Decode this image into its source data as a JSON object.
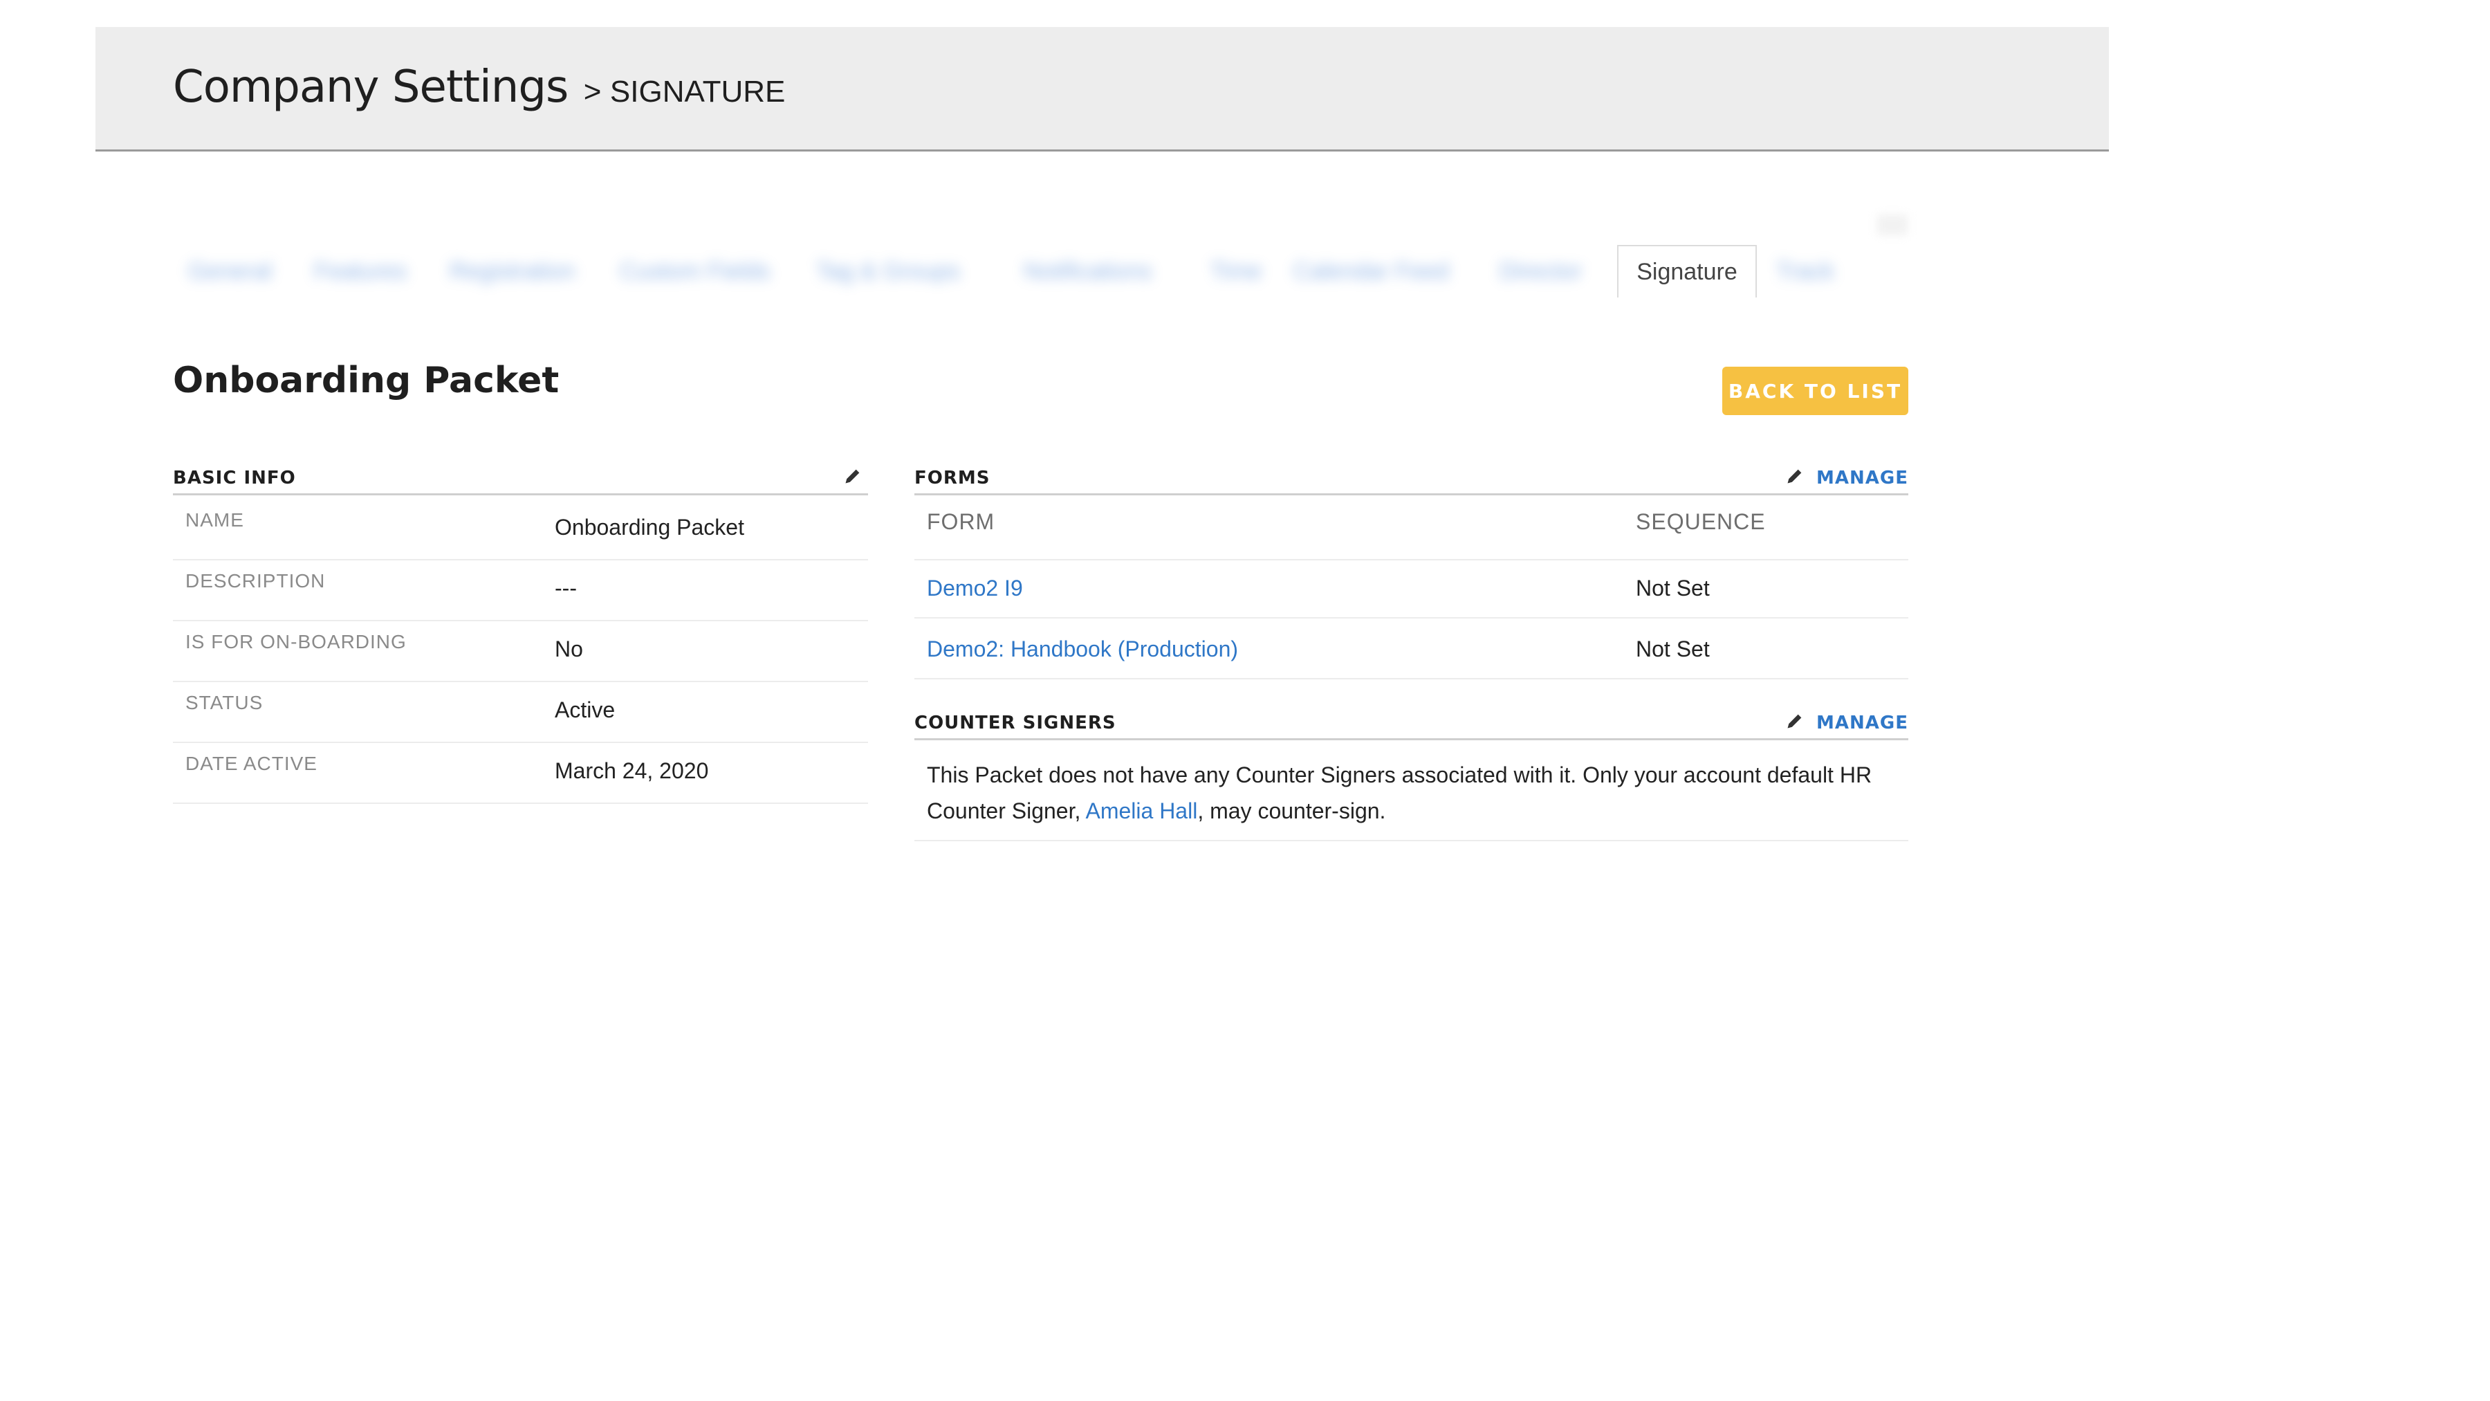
{
  "header": {
    "title": "Company Settings",
    "separator": ">",
    "subtitle": "SIGNATURE"
  },
  "tabs": {
    "blurred": [
      "General",
      "Features",
      "Registration",
      "Custom Fields",
      "Tag & Groups",
      "Notifications",
      "Time",
      "Calendar Feed",
      "Director",
      "Signature",
      "Track"
    ],
    "active": "Signature"
  },
  "page": {
    "title": "Onboarding Packet",
    "back_button": "BACK TO LIST"
  },
  "basic_info": {
    "heading": "BASIC INFO",
    "rows": [
      {
        "key": "NAME",
        "value": "Onboarding Packet"
      },
      {
        "key": "DESCRIPTION",
        "value": "---"
      },
      {
        "key": "IS FOR ON-BOARDING",
        "value": "No"
      },
      {
        "key": "STATUS",
        "value": "Active"
      },
      {
        "key": "DATE ACTIVE",
        "value": "March 24, 2020"
      }
    ]
  },
  "forms": {
    "heading": "FORMS",
    "manage_label": "MANAGE",
    "columns": [
      "FORM",
      "SEQUENCE"
    ],
    "rows": [
      {
        "form": "Demo2 I9",
        "sequence": "Not Set"
      },
      {
        "form": "Demo2: Handbook (Production)",
        "sequence": "Not Set"
      }
    ]
  },
  "counter_signers": {
    "heading": "COUNTER SIGNERS",
    "manage_label": "MANAGE",
    "text_before": "This Packet does not have any Counter Signers associated with it. Only your account default HR Counter Signer, ",
    "link_name": "Amelia Hall",
    "text_after": ", may counter-sign."
  },
  "colors": {
    "accent": "#f6c142",
    "link": "#2f77c7",
    "header_bg": "#ededed"
  },
  "icons": {
    "edit": "pencil-icon"
  }
}
